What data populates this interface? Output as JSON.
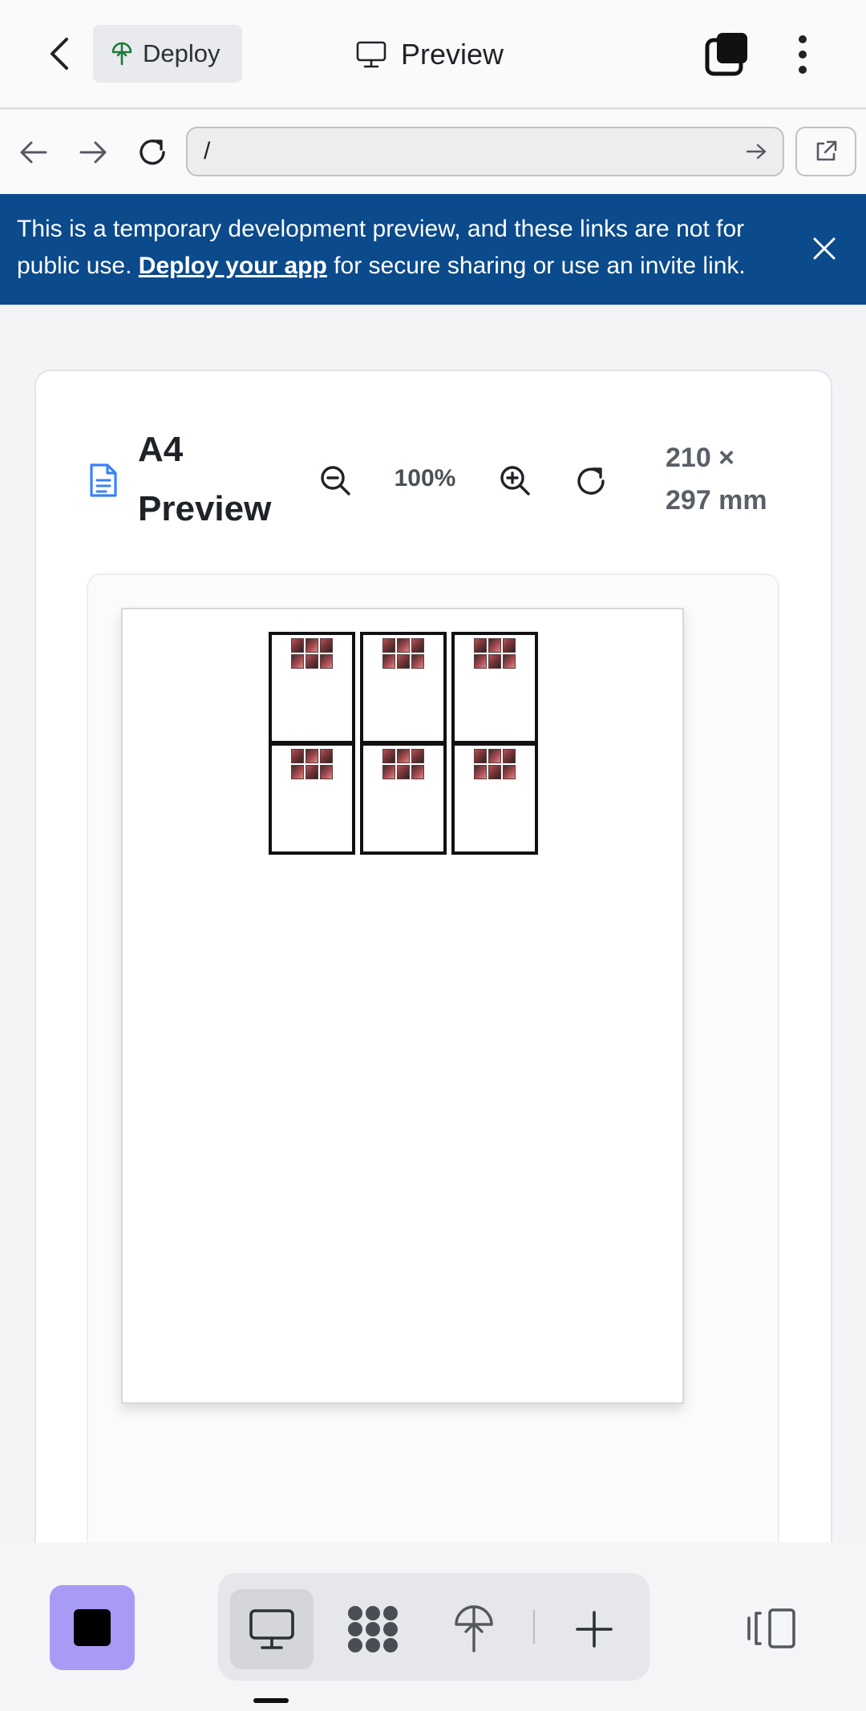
{
  "topbar": {
    "deploy_label": "Deploy",
    "title": "Preview"
  },
  "urlbar": {
    "url": "/"
  },
  "banner": {
    "text_before": "This is a temporary development preview, and these links are not for public use.",
    "link": "Deploy your app",
    "text_after": "for secure sharing or use an invite link."
  },
  "preview": {
    "title": "A4 Preview",
    "zoom": "100%",
    "dimensions": "210 × 297 mm"
  },
  "sheet": {
    "layout": "2 rows × 3 columns",
    "cells": 6,
    "thumbnails_per_cell": 6
  },
  "icons": {
    "back": "chevron-left-icon",
    "deploy": "deploy-umbrella-icon",
    "preview": "monitor-icon",
    "layers": "layers-icon",
    "more": "more-vertical-icon",
    "nav_back": "arrow-left-icon",
    "nav_forward": "arrow-right-icon",
    "reload": "reload-icon",
    "go": "arrow-right-icon",
    "external": "external-link-icon",
    "close": "close-icon",
    "doc": "document-icon",
    "zoom_out": "zoom-out-icon",
    "zoom_in": "zoom-in-icon",
    "reset": "rotate-icon",
    "workspace": "monitor-icon",
    "extensions": "grid-blob-icon",
    "deploy_tool": "deploy-umbrella-icon",
    "add": "plus-icon",
    "panel": "panel-icon"
  },
  "colors": {
    "banner": "#0b4a8b",
    "accent": "#a89bf6",
    "doc_icon": "#3b82f6",
    "deploy_icon": "#1f7a3a"
  }
}
